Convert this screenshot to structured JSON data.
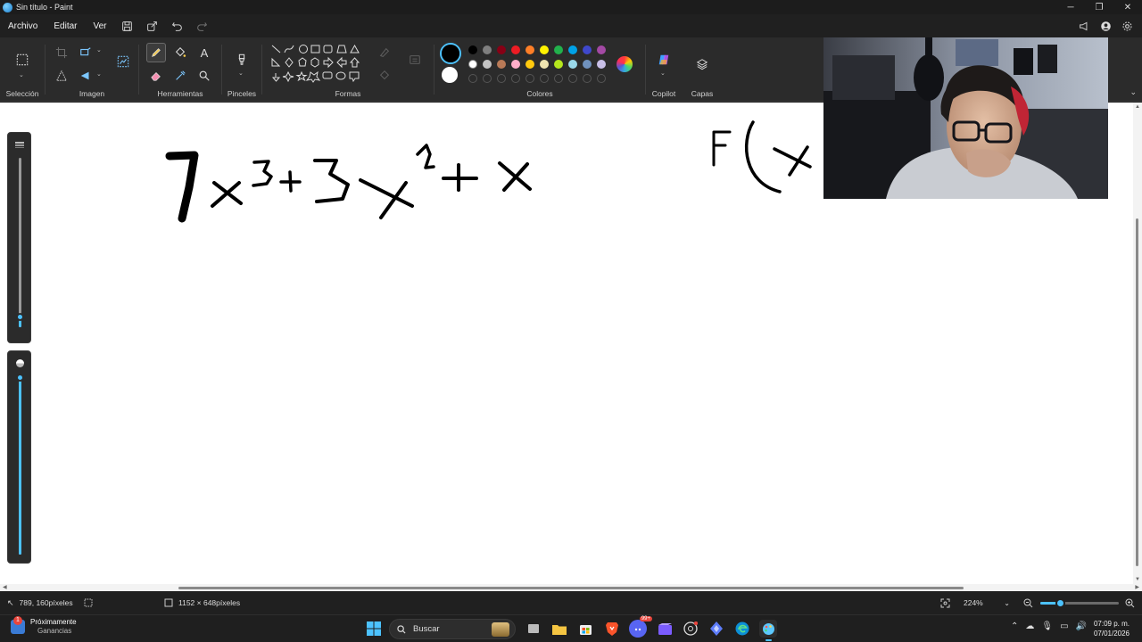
{
  "window": {
    "title": "Sin título - Paint",
    "minimize": "─",
    "maximize": "❐",
    "close": "✕"
  },
  "menu": {
    "file": "Archivo",
    "edit": "Editar",
    "view": "Ver"
  },
  "ribbon": {
    "groups": {
      "selection": "Selección",
      "image": "Imagen",
      "tools": "Herramientas",
      "brushes": "Pinceles",
      "shapes": "Formas",
      "colors": "Colores",
      "copilot": "Copilot",
      "layers": "Capas"
    },
    "active_tool": "pencil",
    "current_color": "#000000",
    "secondary_color": "#ffffff",
    "palette_row1": [
      "#000000",
      "#7f7f7f",
      "#880015",
      "#ed1c24",
      "#ff7f27",
      "#fff200",
      "#22b14c",
      "#00a2e8",
      "#3f48cc",
      "#a349a4"
    ],
    "palette_row2": [
      "#ffffff",
      "#c3c3c3",
      "#b97a57",
      "#ffaec9",
      "#ffc90e",
      "#efe4b0",
      "#b5e61d",
      "#99d9ea",
      "#7092be",
      "#c8bfe7"
    ]
  },
  "canvas": {
    "brush_size_percent": 6,
    "opacity_percent": 100
  },
  "status": {
    "cursor_position": "789, 160píxeles",
    "canvas_size": "1152 × 648píxeles",
    "zoom": "224%",
    "zoom_slider_percent": 25
  },
  "taskbar": {
    "weather_title": "Próximamente",
    "weather_subtitle": "Ganancias",
    "weather_badge": "1",
    "search_label": "Buscar",
    "time": "07:09 p. m.",
    "date": "07/01/2026",
    "notification_badge": "99+"
  }
}
